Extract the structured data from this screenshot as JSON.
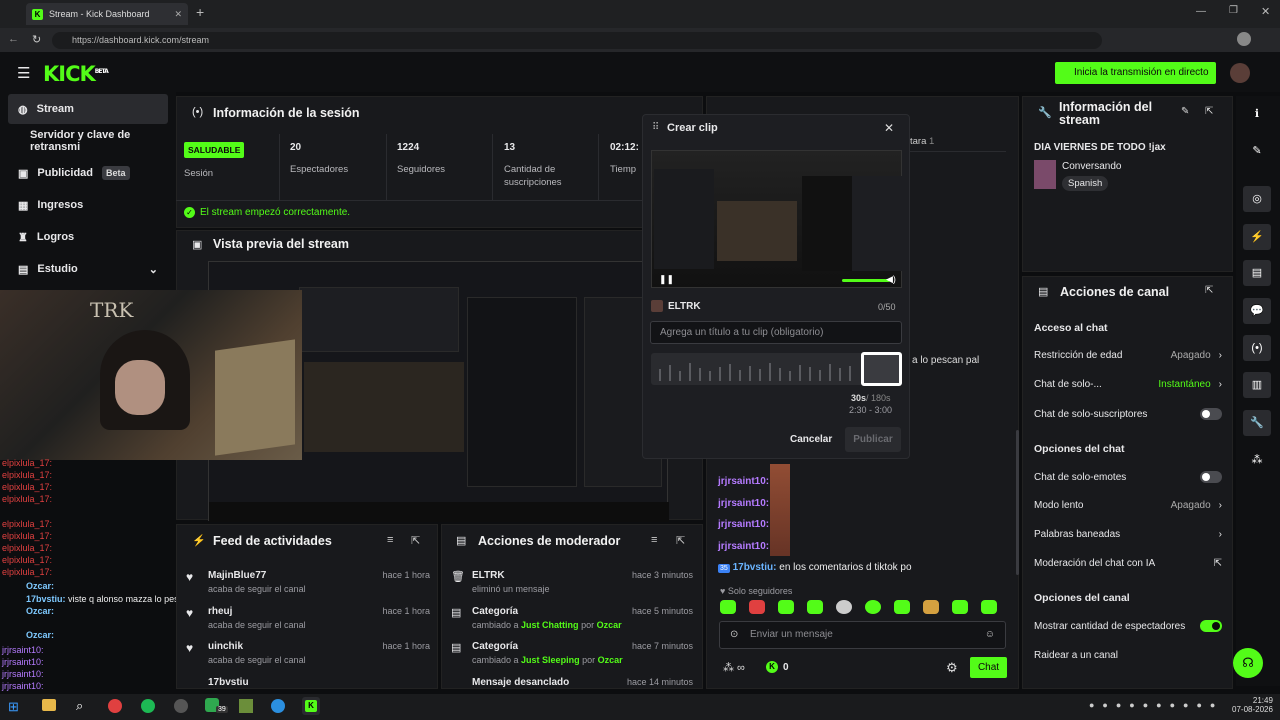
{
  "browser": {
    "tab_title": "Stream - Kick Dashboard",
    "url": "https://dashboard.kick.com/stream"
  },
  "header": {
    "logo_text": "KICK",
    "logo_sup": "BETA",
    "go_live_label": "Inicia la transmisión en directo"
  },
  "sidebar": {
    "items": [
      {
        "label": "Stream",
        "icon": "signal-icon",
        "active": true
      },
      {
        "label": "Servidor y clave de retransmi",
        "icon": "none",
        "active": false
      },
      {
        "label": "Publicidad",
        "icon": "megaphone-icon",
        "badge": "Beta",
        "active": false
      },
      {
        "label": "Ingresos",
        "icon": "chart-icon",
        "active": false
      },
      {
        "label": "Logros",
        "icon": "trophy-icon",
        "active": false
      },
      {
        "label": "Estudio",
        "icon": "studio-icon",
        "active": false
      }
    ]
  },
  "session": {
    "title": "Información de la sesión",
    "status_badge": "SALUDABLE",
    "status_label": "Sesión",
    "stats": [
      {
        "value": "20",
        "label": "Espectadores"
      },
      {
        "value": "1224",
        "label": "Seguidores"
      },
      {
        "value": "13",
        "label": "Cantidad de suscripciones"
      },
      {
        "value": "02:12:",
        "label": "Tiemp"
      }
    ],
    "success_message": "El stream empezó correctamente."
  },
  "preview": {
    "title": "Vista previa del stream"
  },
  "clip_modal": {
    "title": "Crear clip",
    "channel": "ELTRK",
    "char_count": "0/50",
    "title_placeholder": "Agrega un título a tu clip (obligatorio)",
    "duration": "30s",
    "duration_max": "/ 180s",
    "range": "2:30 - 3:00",
    "cancel_label": "Cancelar",
    "publish_label": "Publicar"
  },
  "chat_behind": {
    "tab_text": "tara",
    "tab_count": "1",
    "partial_message": "a lo pescan pal"
  },
  "chat": {
    "messages": [
      {
        "user": "jrjrsaint10:",
        "text": ""
      },
      {
        "user": "jrjrsaint10:",
        "text": ""
      },
      {
        "user": "jrjrsaint10:",
        "text": ""
      },
      {
        "user": "jrjrsaint10:",
        "text": ""
      },
      {
        "user": "17bvstiu:",
        "text": "en los comentarios d tiktok po"
      }
    ],
    "followers_only": "Solo seguidores",
    "input_placeholder": "Enviar un mensaje",
    "counter": "0",
    "send_label": "Chat"
  },
  "activity": {
    "title": "Feed de actividades",
    "items": [
      {
        "user": "MajinBlue77",
        "action": "acaba de seguir el canal",
        "time": "hace 1 hora"
      },
      {
        "user": "rheuj",
        "action": "acaba de seguir el canal",
        "time": "hace 1 hora"
      },
      {
        "user": "uinchik",
        "action": "acaba de seguir el canal",
        "time": "hace 1 hora"
      },
      {
        "user": "17bvstiu",
        "action": "",
        "time": ""
      }
    ]
  },
  "moderator": {
    "title": "Acciones de moderador",
    "items": [
      {
        "title": "ELTRK",
        "detail": "eliminó un mensaje",
        "detail_link": "",
        "by": "",
        "by_user": "",
        "time": "hace 3 minutos"
      },
      {
        "title": "Categoría",
        "detail": "cambiado a",
        "detail_link": "Just Chatting",
        "by": "por",
        "by_user": "Ozcar",
        "time": "hace 5 minutos"
      },
      {
        "title": "Categoría",
        "detail": "cambiado a",
        "detail_link": "Just Sleeping",
        "by": "por",
        "by_user": "Ozcar",
        "time": "hace 7 minutos"
      },
      {
        "title": "Mensaje desanclado",
        "detail": "",
        "detail_link": "",
        "by": "",
        "by_user": "",
        "time": "hace 14 minutos"
      }
    ]
  },
  "stream_info": {
    "title": "Información del stream",
    "stream_title": "DIA VIERNES DE TODO !jax",
    "category": "Conversando",
    "language": "Spanish"
  },
  "channel_actions": {
    "title": "Acciones de canal",
    "chat_access": "Acceso al chat",
    "age_restriction": "Restricción de edad",
    "age_value": "Apagado",
    "solo_chat": "Chat de solo-...",
    "solo_value": "Instantáneo",
    "subs_only": "Chat de solo-suscriptores",
    "chat_options": "Opciones del chat",
    "emotes_only": "Chat de solo-emotes",
    "slow_mode": "Modo lento",
    "slow_value": "Apagado",
    "banned_words": "Palabras baneadas",
    "ai_moderation": "Moderación del chat con IA",
    "channel_options": "Opciones del canal",
    "show_viewers": "Mostrar cantidad de espectadores",
    "raid": "Raidear a un canal"
  },
  "overlay_chat": {
    "lines": [
      {
        "user": "elpixlula_17:"
      },
      {
        "user": "elpixlula_17:"
      },
      {
        "user": "elpixlula_17:"
      },
      {
        "user": "elpixlula_17:"
      },
      {
        "user": "Ozcar:"
      },
      {
        "user": "17bvstiu:",
        "text": "viste q alonso mazza lo pescan pal webeo y ahora le dicen q esta muerto"
      },
      {
        "user": "Ozcar:"
      },
      {
        "user": "Ozcar:"
      },
      {
        "user": "jrjrsaint10:"
      },
      {
        "user": "jrjrsaint10:"
      },
      {
        "user": "jrjrsaint10:"
      },
      {
        "user": "jrjrsaint10:"
      }
    ]
  },
  "overlay_text": "TRK",
  "taskbar": {
    "time": "21:49",
    "date": "07-08-2026",
    "badge": "39"
  }
}
